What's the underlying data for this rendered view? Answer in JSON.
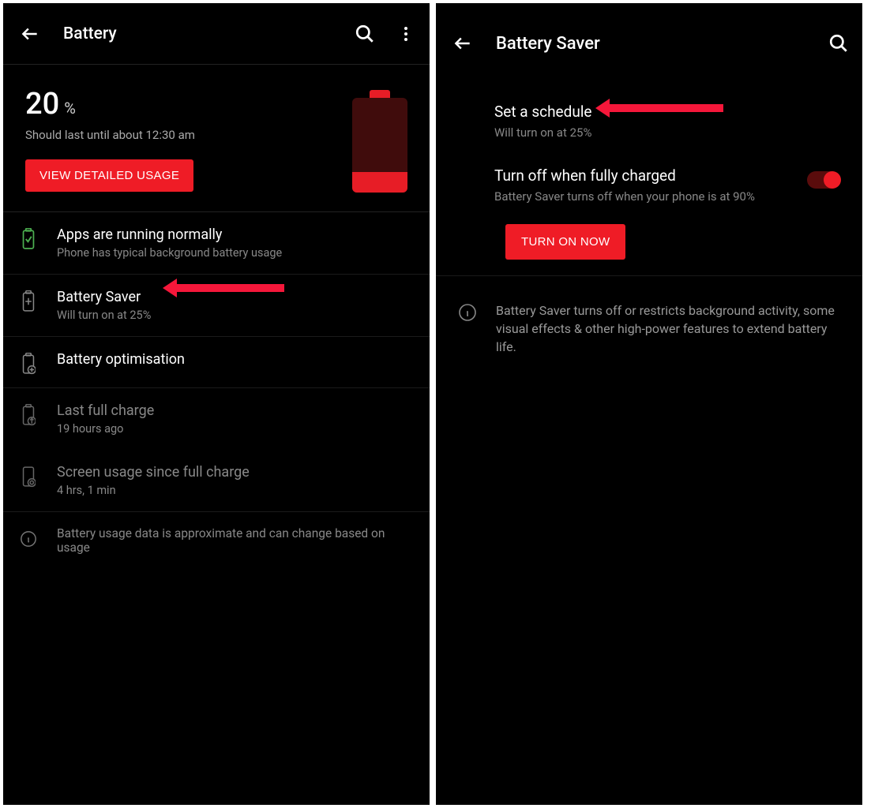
{
  "left": {
    "title": "Battery",
    "percent": "20",
    "percent_sign": "%",
    "estimate": "Should last until about 12:30 am",
    "view_detail_btn": "VIEW DETAILED USAGE",
    "items": [
      {
        "title": "Apps are running normally",
        "sub": "Phone has typical background battery usage"
      },
      {
        "title": "Battery Saver",
        "sub": "Will turn on at 25%"
      },
      {
        "title": "Battery optimisation",
        "sub": ""
      },
      {
        "title": "Last full charge",
        "sub": "19 hours ago"
      },
      {
        "title": "Screen usage since full charge",
        "sub": "4 hrs, 1 min"
      },
      {
        "title": "Battery usage data is approximate and can change based on usage",
        "sub": ""
      }
    ]
  },
  "right": {
    "title": "Battery Saver",
    "schedule_title": "Set a schedule",
    "schedule_sub": "Will turn on at 25%",
    "fully_title": "Turn off when fully charged",
    "fully_sub": "Battery Saver turns off when your phone is at 90%",
    "turn_on_btn": "TURN ON NOW",
    "info": "Battery Saver turns off or restricts background activity, some visual effects & other high-power features to extend battery life."
  },
  "colors": {
    "accent": "#ef1c26"
  }
}
